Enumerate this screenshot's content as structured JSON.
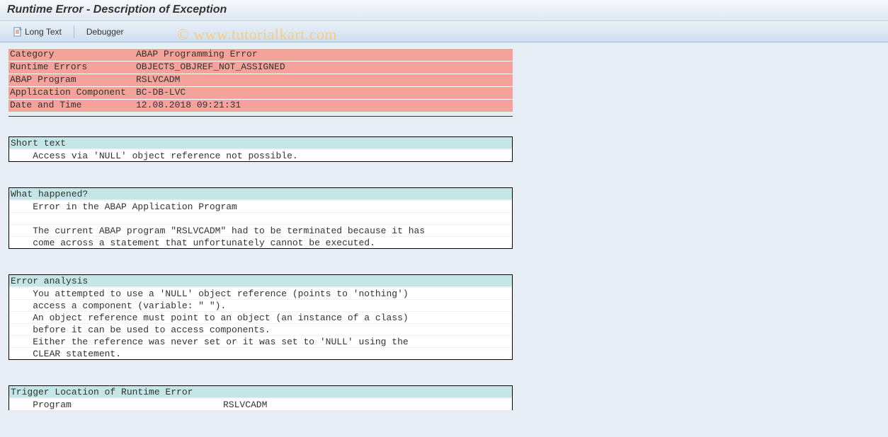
{
  "title": "Runtime Error - Description of Exception",
  "toolbar": {
    "long_text_label": "Long Text",
    "debugger_label": "Debugger"
  },
  "summary": {
    "category_key": "Category",
    "category_val": "ABAP Programming Error",
    "runtime_errors_key": "Runtime Errors",
    "runtime_errors_val": "OBJECTS_OBJREF_NOT_ASSIGNED",
    "abap_program_key": "ABAP Program",
    "abap_program_val": "RSLVCADM",
    "app_component_key": "Application Component",
    "app_component_val": "BC-DB-LVC",
    "datetime_key": "Date and Time",
    "datetime_val": "12.08.2018 09:21:31"
  },
  "short_text": {
    "title": "Short text",
    "line1": "    Access via 'NULL' object reference not possible."
  },
  "what_happened": {
    "title": "What happened?",
    "line1": "    Error in the ABAP Application Program",
    "blank": " ",
    "line2": "    The current ABAP program \"RSLVCADM\" had to be terminated because it has",
    "line3": "    come across a statement that unfortunately cannot be executed."
  },
  "error_analysis": {
    "title": "Error analysis",
    "line1": "    You attempted to use a 'NULL' object reference (points to 'nothing')",
    "line2": "    access a component (variable: \" \").",
    "line3": "    An object reference must point to an object (an instance of a class)",
    "line4": "    before it can be used to access components.",
    "line5": "    Either the reference was never set or it was set to 'NULL' using the",
    "line6": "    CLEAR statement."
  },
  "trigger": {
    "title": "Trigger Location of Runtime Error",
    "program_key": "    Program",
    "program_val": "RSLVCADM"
  },
  "watermark": "©  www.tutorialkart.com"
}
